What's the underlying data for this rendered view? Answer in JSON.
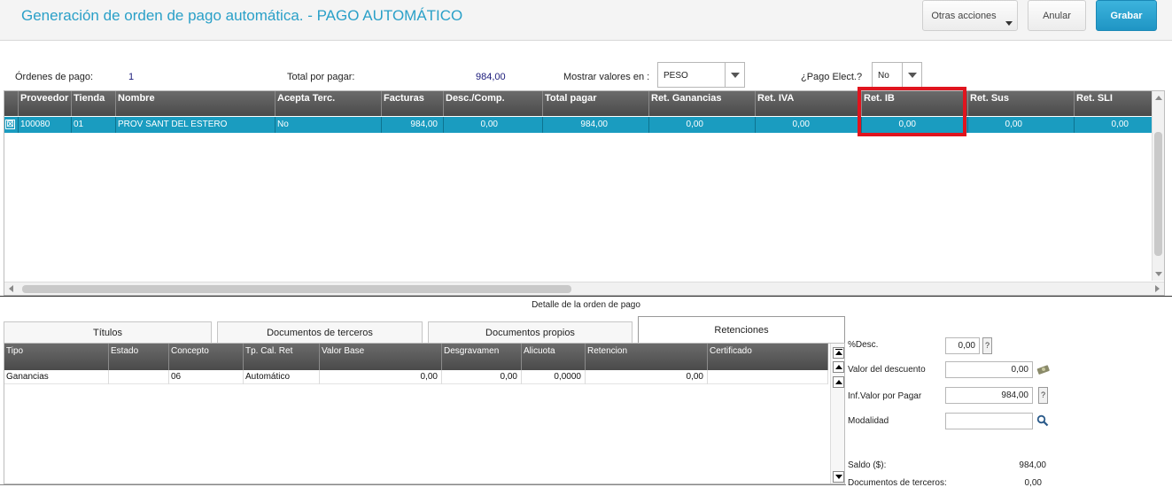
{
  "header": {
    "title": "Generación de orden de pago automática. - PAGO AUTOMÁTICO",
    "otras_acciones": "Otras acciones",
    "anular": "Anular",
    "grabar": "Grabar"
  },
  "info": {
    "ordenes_label": "Órdenes de pago:",
    "ordenes_value": "1",
    "total_label": "Total por pagar:",
    "total_value": "984,00",
    "mostrar_label": "Mostrar valores en :",
    "mostrar_value": "PESO",
    "pago_elect_label": "¿Pago Elect.?",
    "pago_elect_value": "No"
  },
  "top_grid": {
    "headers": [
      "Proveedor",
      "Tienda",
      "Nombre",
      "Acepta Terc.",
      "Facturas",
      "Desc./Comp.",
      "Total pagar",
      "Ret. Ganancias",
      "Ret. IVA",
      "Ret. IB",
      "Ret. Sus",
      "Ret. SLI"
    ],
    "row": [
      "100080",
      "01",
      "PROV SANT DEL ESTERO",
      "No",
      "984,00",
      "0,00",
      "984,00",
      "0,00",
      "0,00",
      "0,00",
      "0,00",
      "0,00"
    ],
    "row_checkbox": "☒"
  },
  "detail": {
    "title": "Detalle de la orden de pago",
    "tabs": [
      "Títulos",
      "Documentos de terceros",
      "Documentos propios",
      "Retenciones"
    ]
  },
  "bottom_grid": {
    "headers": [
      "Tipo",
      "Estado",
      "Concepto",
      "Tp. Cal. Ret",
      "Valor Base",
      "Desgravamen",
      "Alicuota",
      "Retencion",
      "Certificado"
    ],
    "row": [
      "Ganancias",
      "",
      "06",
      "Automático",
      "0,00",
      "0,00",
      "0,0000",
      "0,00",
      ""
    ]
  },
  "right_panel": {
    "desc_label": "%Desc.",
    "desc_value": "0,00",
    "valor_desc_label": "Valor del descuento",
    "valor_desc_value": "0,00",
    "inf_valor_label": "Inf.Valor por Pagar",
    "inf_valor_value": "984,00",
    "modalidad_label": "Modalidad",
    "modalidad_value": "",
    "saldo_label": "Saldo ($):",
    "saldo_value": "984,00",
    "docs_terceros_label": "Documentos de terceros:",
    "docs_terceros_value": "0,00",
    "help_glyph": "?"
  }
}
